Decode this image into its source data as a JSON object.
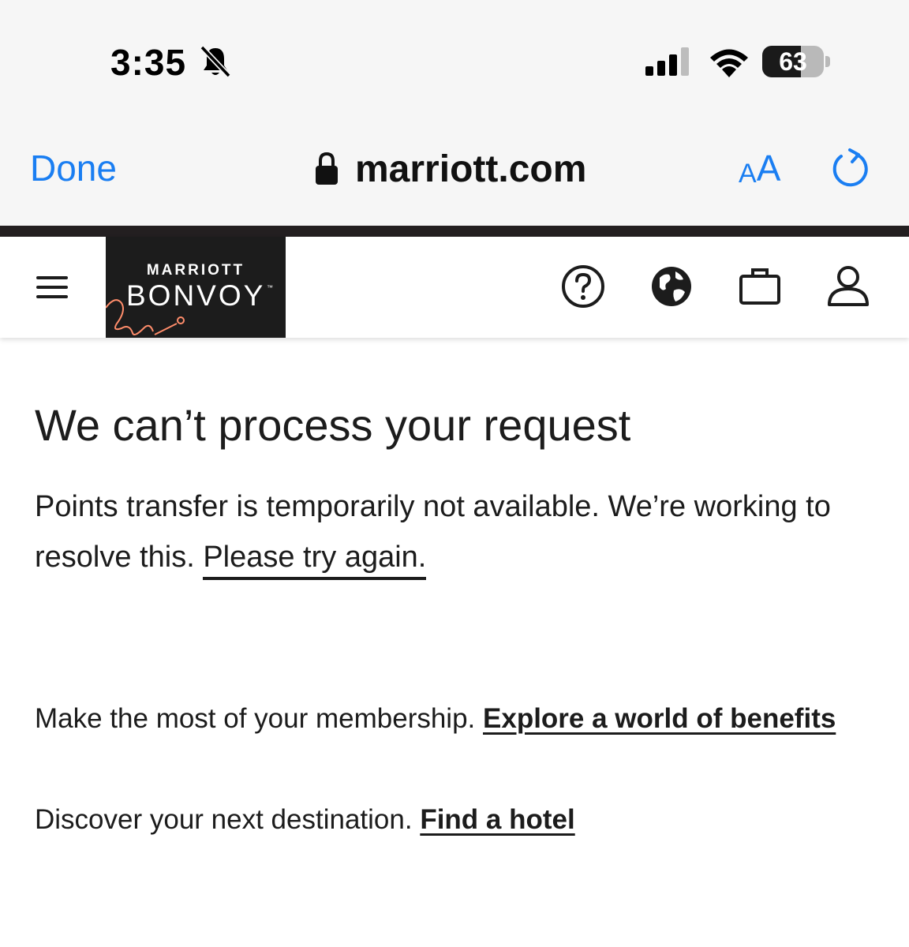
{
  "status_bar": {
    "time": "3:35",
    "battery_level": "63",
    "battery_fraction": 0.63
  },
  "browser": {
    "done_label": "Done",
    "url": "marriott.com",
    "text_size_small": "A",
    "text_size_large": "A"
  },
  "header": {
    "logo_line1": "MARRIOTT",
    "logo_line2": "BONVOY",
    "logo_tm": "™"
  },
  "main": {
    "title": "We can’t process your request",
    "message": "Points transfer is temporarily not available. We’re working to resolve this.",
    "retry_link": "Please try again.",
    "membership_text": "Make the most of your membership.",
    "membership_link": "Explore a world of benefits",
    "discover_text": "Discover your next destination.",
    "discover_link": "Find a hotel"
  },
  "colors": {
    "ios_blue": "#1a7ef2",
    "brand_dark": "#1c1c1c",
    "brand_accent": "#ff8d6b"
  }
}
